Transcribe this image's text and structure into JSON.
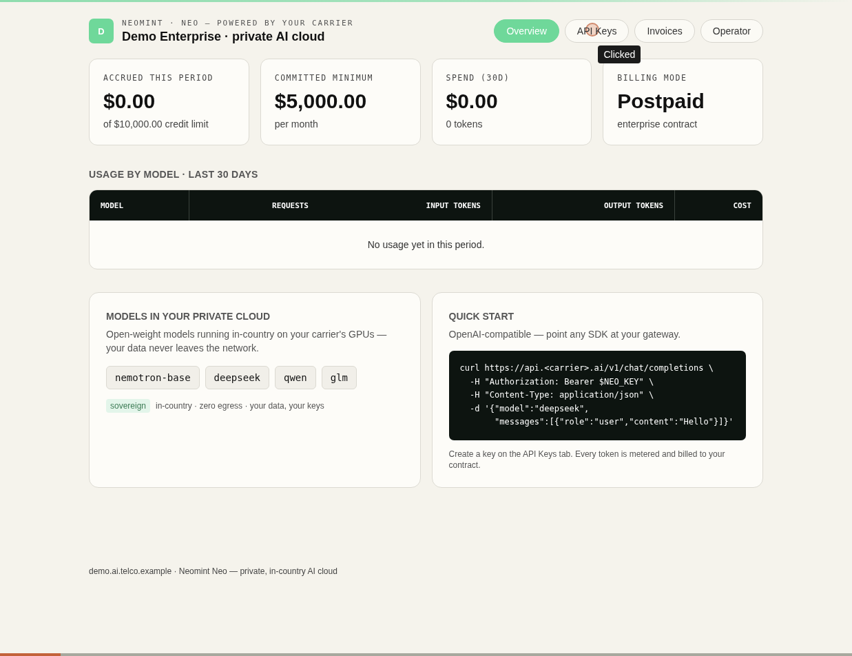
{
  "brand": {
    "avatar": "D",
    "kicker": "NEOMINT · NEO — POWERED BY YOUR CARRIER",
    "title": "Demo Enterprise · private AI cloud"
  },
  "tabs": [
    {
      "label": "Overview",
      "selected": true
    },
    {
      "label": "API Keys",
      "selected": false
    },
    {
      "label": "Invoices",
      "selected": false
    },
    {
      "label": "Operator",
      "selected": false
    }
  ],
  "click_tooltip": "Clicked",
  "stats": [
    {
      "label": "ACCRUED THIS PERIOD",
      "value": "$0.00",
      "note": "of $10,000.00 credit limit"
    },
    {
      "label": "COMMITTED MINIMUM",
      "value": "$5,000.00",
      "note": "per month"
    },
    {
      "label": "SPEND (30D)",
      "value": "$0.00",
      "note": "0 tokens"
    },
    {
      "label": "BILLING MODE",
      "value": "Postpaid",
      "note": "enterprise contract"
    }
  ],
  "usage": {
    "title": "USAGE BY MODEL · LAST 30 DAYS",
    "columns": [
      "MODEL",
      "REQUESTS",
      "INPUT TOKENS",
      "OUTPUT TOKENS",
      "COST"
    ],
    "empty": "No usage yet in this period."
  },
  "models_panel": {
    "title": "MODELS IN YOUR PRIVATE CLOUD",
    "text": "Open-weight models running in-country on your carrier's GPUs — your data never leaves the network.",
    "models": [
      "nemotron-base",
      "deepseek",
      "qwen",
      "glm"
    ],
    "tag": "sovereign",
    "tag_note": "in-country · zero egress · your data, your keys"
  },
  "quick_start": {
    "title": "QUICK START",
    "text": "OpenAI-compatible — point any SDK at your gateway.",
    "code": [
      "curl https://api.<carrier>.ai/v1/chat/completions \\",
      "  -H \"Authorization: Bearer $NEO_KEY\" \\",
      "  -H \"Content-Type: application/json\" \\",
      "  -d '{\"model\":\"deepseek\",",
      "       \"messages\":[{\"role\":\"user\",\"content\":\"Hello\"}]}'"
    ],
    "note": "Create a key on the API Keys tab. Every token is metered and billed to your contract."
  },
  "footer": "demo.ai.telco.example · Neomint Neo — private, in-country AI cloud",
  "bottom_progress": {
    "level": 0.071
  }
}
